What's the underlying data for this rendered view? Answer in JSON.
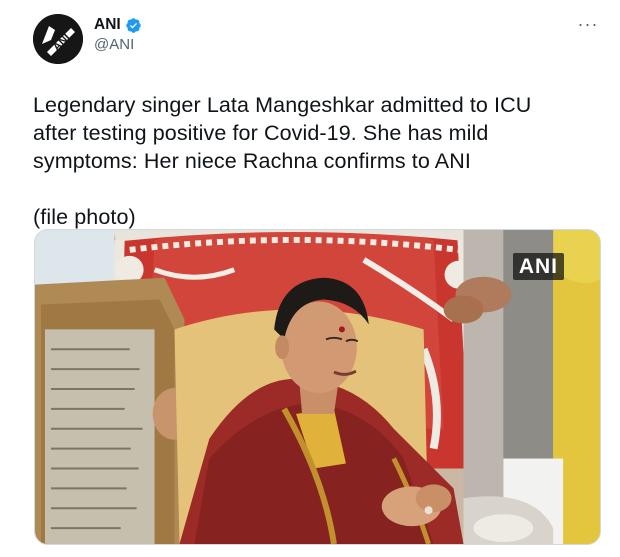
{
  "author": {
    "display_name": "ANI",
    "handle": "@ANI",
    "avatar_logo_text": "ANI",
    "verified": true
  },
  "tweet": {
    "text": "Legendary singer Lata Mangeshkar admitted to ICU\nafter testing positive for Covid-19. She has mild\nsymptoms: Her niece Rachna confirms to ANI\n\n(file photo)"
  },
  "media": {
    "watermark": "ANI",
    "description": "photo"
  },
  "icons": {
    "more": "more-options-icon",
    "verified": "verified-badge-icon"
  },
  "colors": {
    "verified_blue": "#1d9bf0",
    "text_primary": "#0f1419",
    "text_secondary": "#536471"
  }
}
